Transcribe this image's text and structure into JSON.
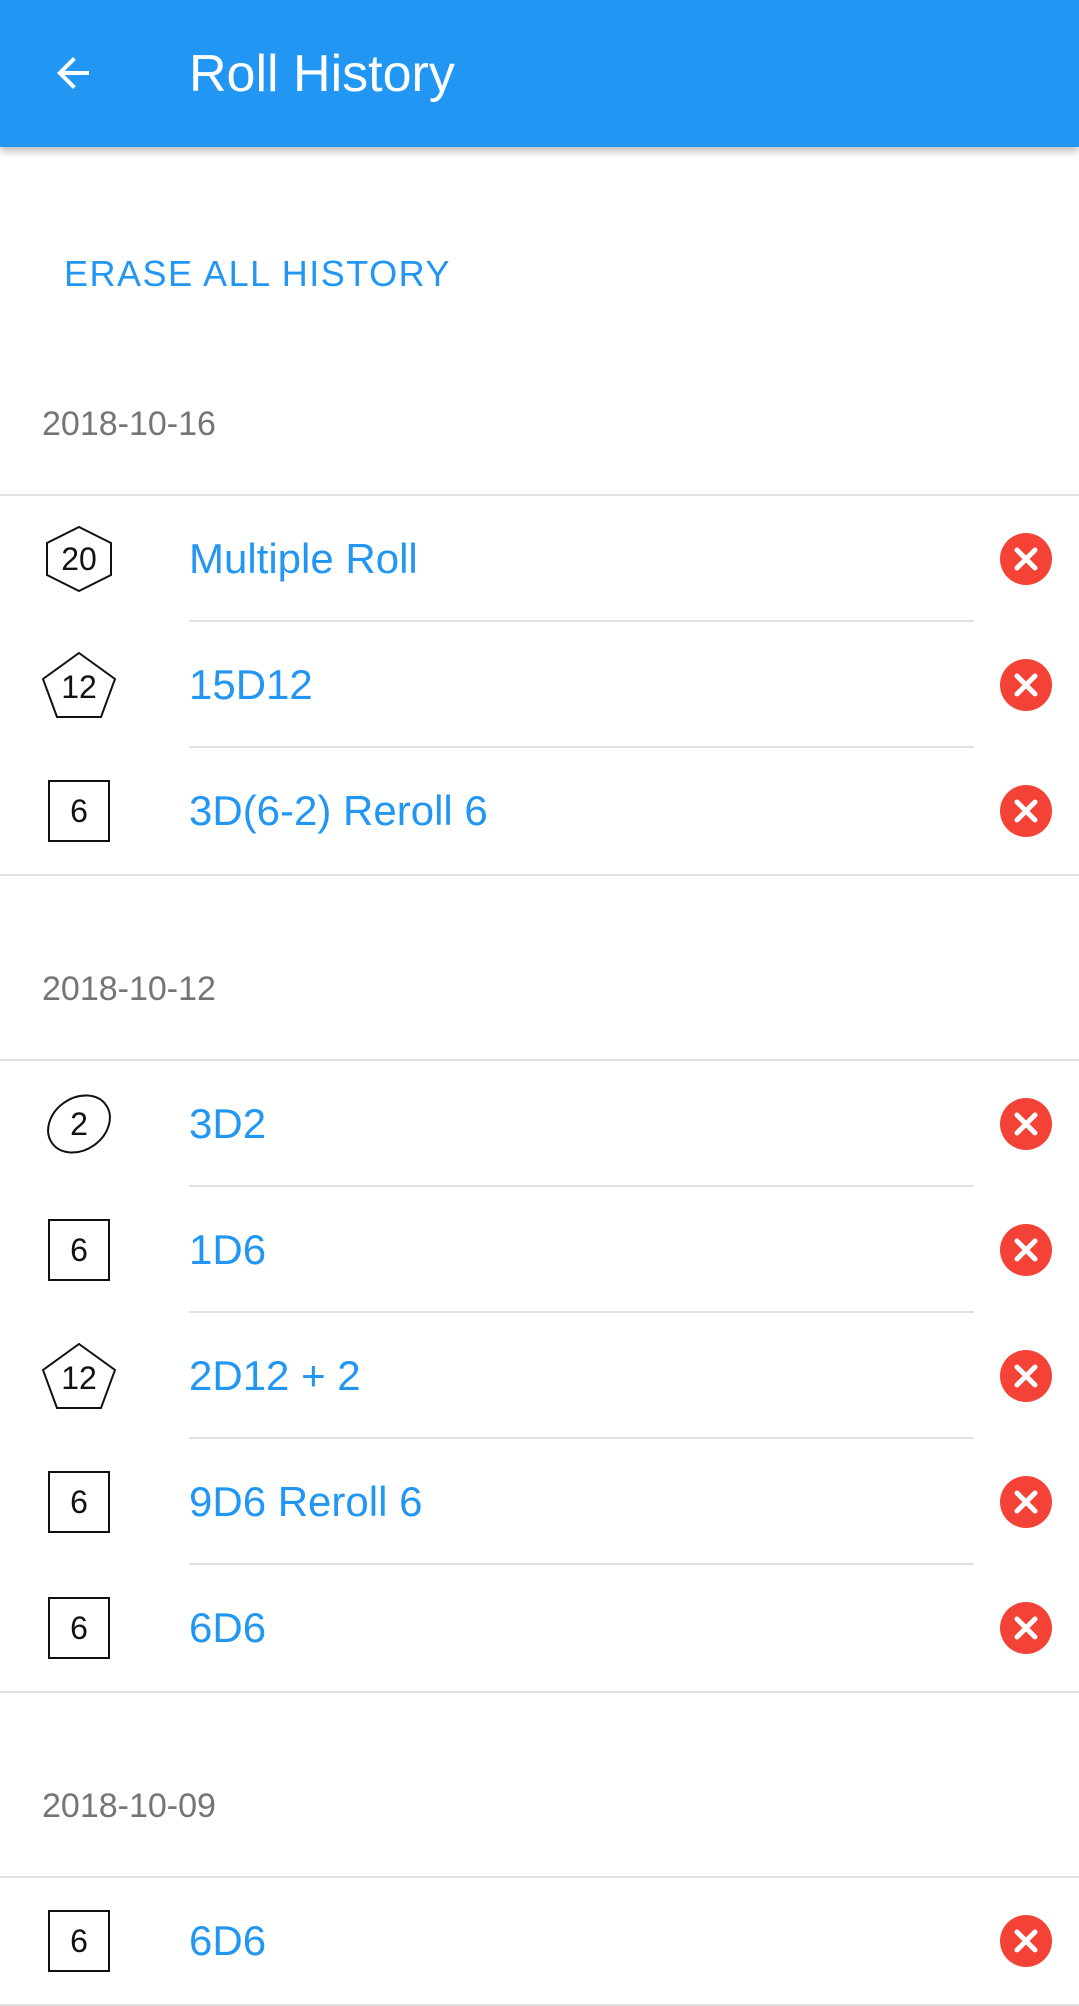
{
  "app_bar": {
    "back_icon": "arrow-left-icon",
    "title": "Roll History"
  },
  "erase_all_label": "ERASE ALL HISTORY",
  "colors": {
    "primary": "#2196F3",
    "delete": "#F44336",
    "date_text": "#757575"
  },
  "groups": [
    {
      "date": "2018-10-16",
      "rolls": [
        {
          "die": "d20",
          "die_label": "20",
          "label": "Multiple Roll"
        },
        {
          "die": "d12",
          "die_label": "12",
          "label": "15D12"
        },
        {
          "die": "d6",
          "die_label": "6",
          "label": "3D(6-2) Reroll 6"
        }
      ]
    },
    {
      "date": "2018-10-12",
      "rolls": [
        {
          "die": "d2",
          "die_label": "2",
          "label": "3D2"
        },
        {
          "die": "d6",
          "die_label": "6",
          "label": "1D6"
        },
        {
          "die": "d12",
          "die_label": "12",
          "label": "2D12 + 2"
        },
        {
          "die": "d6",
          "die_label": "6",
          "label": "9D6 Reroll 6"
        },
        {
          "die": "d6",
          "die_label": "6",
          "label": "6D6"
        }
      ]
    },
    {
      "date": "2018-10-09",
      "rolls": [
        {
          "die": "d6",
          "die_label": "6",
          "label": "6D6"
        }
      ]
    }
  ]
}
